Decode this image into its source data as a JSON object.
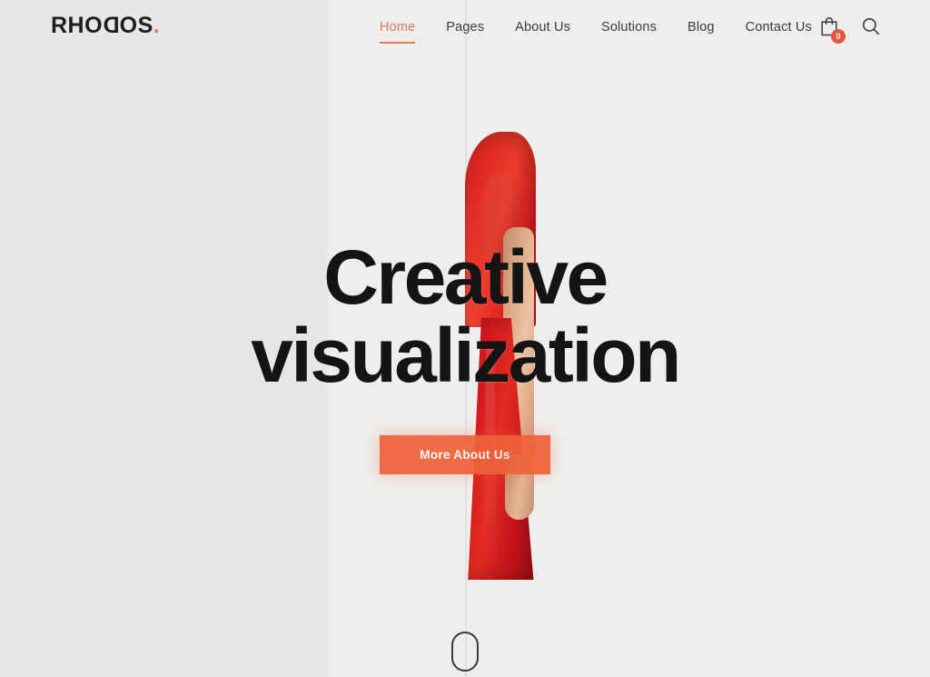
{
  "site": {
    "logo_text": "RHO",
    "logo_mirror_letter": "D",
    "logo_text_end": "OS",
    "logo_dot": "."
  },
  "nav": {
    "items": [
      {
        "label": "Home",
        "active": true
      },
      {
        "label": "Pages",
        "active": false
      },
      {
        "label": "About Us",
        "active": false
      },
      {
        "label": "Solutions",
        "active": false
      },
      {
        "label": "Blog",
        "active": false
      },
      {
        "label": "Contact Us",
        "active": false
      }
    ]
  },
  "header_icons": {
    "cart_icon": "shopping-bag-icon",
    "cart_count": "0",
    "search_icon": "search-icon"
  },
  "hero": {
    "headline_line1": "Creative",
    "headline_line2": "visualization",
    "cta_label": "More About Us",
    "scroll_hint": "scroll-down-indicator"
  },
  "colors": {
    "accent_orange": "#ef6239",
    "nav_active": "#e0785c",
    "badge_red": "#e8563a",
    "headline_dark": "#141414",
    "bg_left": "#e7e6e6",
    "bg_right": "#efeeec",
    "dress_red": "#e32a22"
  }
}
